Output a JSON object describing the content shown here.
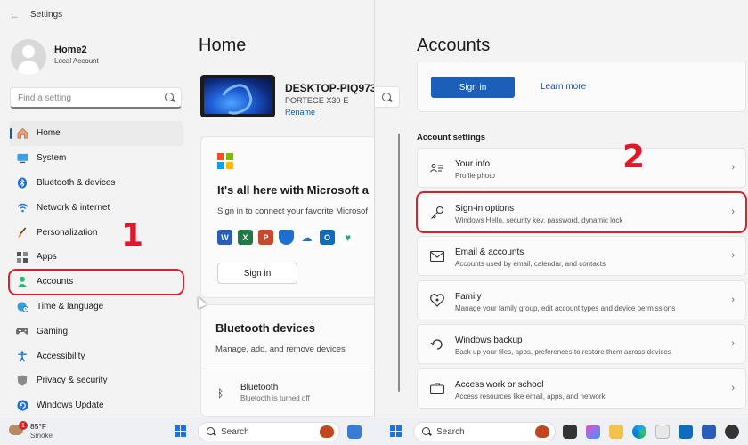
{
  "left": {
    "window_title": "Settings",
    "profile": {
      "name": "Home2",
      "type": "Local Account"
    },
    "search": {
      "placeholder": "Find a setting"
    },
    "nav": [
      {
        "label": "Home",
        "icon": "home-icon"
      },
      {
        "label": "System",
        "icon": "monitor-icon"
      },
      {
        "label": "Bluetooth & devices",
        "icon": "bluetooth-icon"
      },
      {
        "label": "Network & internet",
        "icon": "wifi-icon"
      },
      {
        "label": "Personalization",
        "icon": "brush-icon"
      },
      {
        "label": "Apps",
        "icon": "apps-icon"
      },
      {
        "label": "Accounts",
        "icon": "person-icon"
      },
      {
        "label": "Time & language",
        "icon": "globe-clock-icon"
      },
      {
        "label": "Gaming",
        "icon": "gamepad-icon"
      },
      {
        "label": "Accessibility",
        "icon": "accessibility-icon"
      },
      {
        "label": "Privacy & security",
        "icon": "shield-icon"
      },
      {
        "label": "Windows Update",
        "icon": "update-icon"
      }
    ],
    "active_nav": "Home",
    "annotation_number": "1",
    "page_title": "Home",
    "device": {
      "name": "DESKTOP-PIQ973",
      "model": "PORTEGE X30-E",
      "rename_label": "Rename"
    },
    "ms_card": {
      "heading": "It's all here with Microsoft a",
      "subtext": "Sign in to connect your favorite Microsof",
      "sign_in_label": "Sign in"
    },
    "bt_card": {
      "heading": "Bluetooth devices",
      "subtext": "Manage, add, and remove devices",
      "item_label": "Bluetooth",
      "item_status": "Bluetooth is turned off"
    }
  },
  "right": {
    "page_title": "Accounts",
    "sign_in_label": "Sign in",
    "learn_more_label": "Learn more",
    "section_title": "Account settings",
    "annotation_number": "2",
    "rows": [
      {
        "label": "Your info",
        "sub": "Profile photo",
        "icon": "id-card-icon"
      },
      {
        "label": "Sign-in options",
        "sub": "Windows Hello, security key, password, dynamic lock",
        "icon": "key-icon"
      },
      {
        "label": "Email & accounts",
        "sub": "Accounts used by email, calendar, and contacts",
        "icon": "mail-icon"
      },
      {
        "label": "Family",
        "sub": "Manage your family group, edit account types and device permissions",
        "icon": "family-heart-icon"
      },
      {
        "label": "Windows backup",
        "sub": "Back up your files, apps, preferences to restore them across devices",
        "icon": "backup-icon"
      },
      {
        "label": "Access work or school",
        "sub": "Access resources like email, apps, and network",
        "icon": "briefcase-icon"
      }
    ]
  },
  "taskbar": {
    "weather_temp": "85°F",
    "weather_cond": "Smoke",
    "weather_badge": "1",
    "search_label": "Search"
  },
  "colors": {
    "accent": "#005fb8",
    "highlight": "#d6222f",
    "annotation": "#e0192a"
  }
}
